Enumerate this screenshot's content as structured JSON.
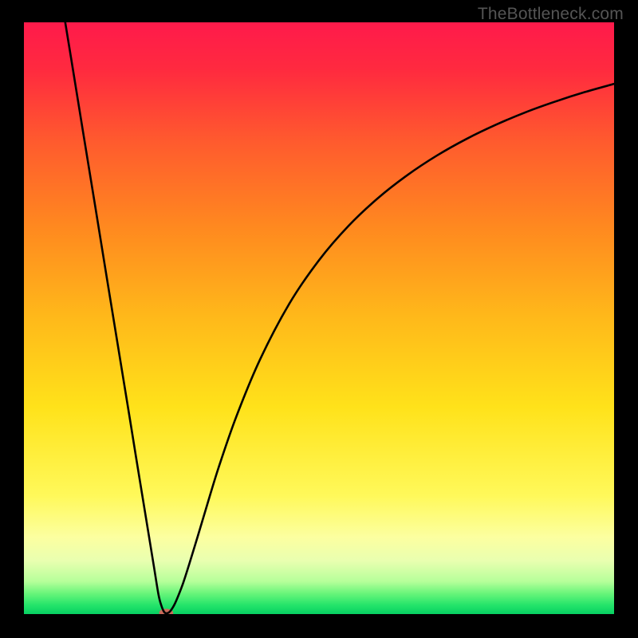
{
  "watermark": "TheBottleneck.com",
  "chart_data": {
    "type": "line",
    "title": "",
    "xlabel": "",
    "ylabel": "",
    "xlim": [
      0,
      100
    ],
    "ylim": [
      0,
      100
    ],
    "grid": false,
    "legend": false,
    "background_gradient": {
      "stops": [
        {
          "offset": 0.0,
          "color": "#ff1a4b"
        },
        {
          "offset": 0.08,
          "color": "#ff2a3f"
        },
        {
          "offset": 0.2,
          "color": "#ff5a2e"
        },
        {
          "offset": 0.35,
          "color": "#ff8a1f"
        },
        {
          "offset": 0.5,
          "color": "#ffb91a"
        },
        {
          "offset": 0.65,
          "color": "#ffe21a"
        },
        {
          "offset": 0.8,
          "color": "#fff95a"
        },
        {
          "offset": 0.87,
          "color": "#fcffa0"
        },
        {
          "offset": 0.91,
          "color": "#e9ffb0"
        },
        {
          "offset": 0.945,
          "color": "#b6ff9a"
        },
        {
          "offset": 0.965,
          "color": "#69f57a"
        },
        {
          "offset": 0.985,
          "color": "#24e46a"
        },
        {
          "offset": 1.0,
          "color": "#07d062"
        }
      ]
    },
    "series": [
      {
        "name": "curve",
        "color": "#000000",
        "x": [
          7,
          8,
          10,
          12,
          14,
          16,
          18,
          19,
          20,
          21,
          22,
          22.8,
          23.3,
          23.8,
          24.3,
          24.8,
          25.5,
          26.2,
          27,
          28,
          29.5,
          31,
          33,
          36,
          40,
          45,
          50,
          55,
          60,
          65,
          70,
          75,
          80,
          85,
          90,
          95,
          100
        ],
        "y": [
          100,
          93.9,
          81.6,
          69.4,
          57.1,
          44.9,
          32.7,
          26.5,
          20.4,
          14.3,
          8.2,
          3.3,
          1.4,
          0.3,
          0.15,
          0.5,
          1.6,
          3.2,
          5.3,
          8.4,
          13.3,
          18.3,
          24.8,
          33.4,
          43.0,
          52.5,
          59.8,
          65.6,
          70.3,
          74.2,
          77.5,
          80.3,
          82.7,
          84.8,
          86.6,
          88.2,
          89.6
        ]
      }
    ],
    "marker": {
      "x": 24.1,
      "y": 0.2,
      "rx": 1.2,
      "ry": 0.7,
      "color": "#c96a5a"
    }
  }
}
